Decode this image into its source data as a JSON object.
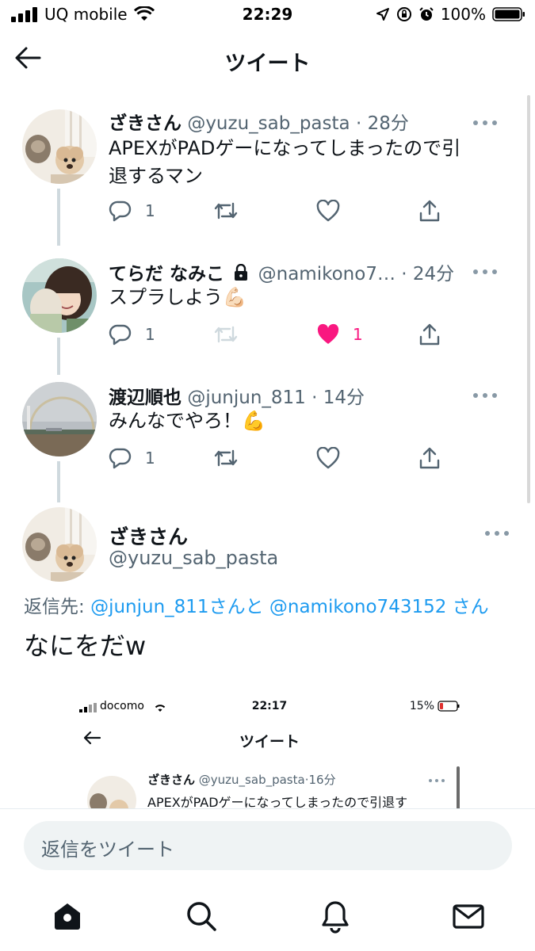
{
  "status_bar": {
    "carrier": "UQ mobile",
    "time": "22:29",
    "battery": "100%"
  },
  "header": {
    "title": "ツイート"
  },
  "thread": [
    {
      "name": "ざきさん",
      "handle": "@yuzu_sab_pasta",
      "dot": "·",
      "time": "28分",
      "text_line1": "APEXがPADゲーになってしまったので引",
      "text_line2": "退するマン",
      "reply_count": "1",
      "retweet_count": "",
      "like_count": "",
      "liked": false,
      "protected": false
    },
    {
      "name": "てらだ なみこ",
      "handle": "@namikono7…",
      "dot": "·",
      "time": "24分",
      "text_line1": "スプラしよう💪🏻",
      "text_line2": "",
      "reply_count": "1",
      "retweet_count": "",
      "like_count": "1",
      "liked": true,
      "protected": true
    },
    {
      "name": "渡辺順也",
      "handle": "@junjun_811",
      "dot": "·",
      "time": "14分",
      "text_line1": "みんなでやろ！💪",
      "text_line2": "",
      "reply_count": "1",
      "retweet_count": "",
      "like_count": "",
      "liked": false,
      "protected": false
    }
  ],
  "main_tweet": {
    "name": "ざきさん",
    "handle": "@yuzu_sab_pasta",
    "reply_prefix": "返信先: ",
    "mention1": "@junjun_811",
    "joiner": "さんと ",
    "mention2": "@namikono743152",
    "suffix": " さん",
    "text": "なにをだw"
  },
  "embedded_screenshot": {
    "carrier": "docomo",
    "time": "22:17",
    "battery": "15%",
    "title": "ツイート",
    "name": "ざきさん",
    "handle": "@yuzu_sab_pasta",
    "dot": "·",
    "time_ago": "16分",
    "text": "APEXがPADゲーになってしまったので引退す"
  },
  "reply_box": {
    "placeholder": "返信をツイート"
  },
  "tabbar": {
    "items": [
      "home-icon",
      "search-icon",
      "notifications-icon",
      "messages-icon"
    ]
  },
  "colors": {
    "accent": "#1d9bf0",
    "like": "#f91880",
    "secondary_text": "#536471",
    "thread_line": "#cfd9de"
  }
}
